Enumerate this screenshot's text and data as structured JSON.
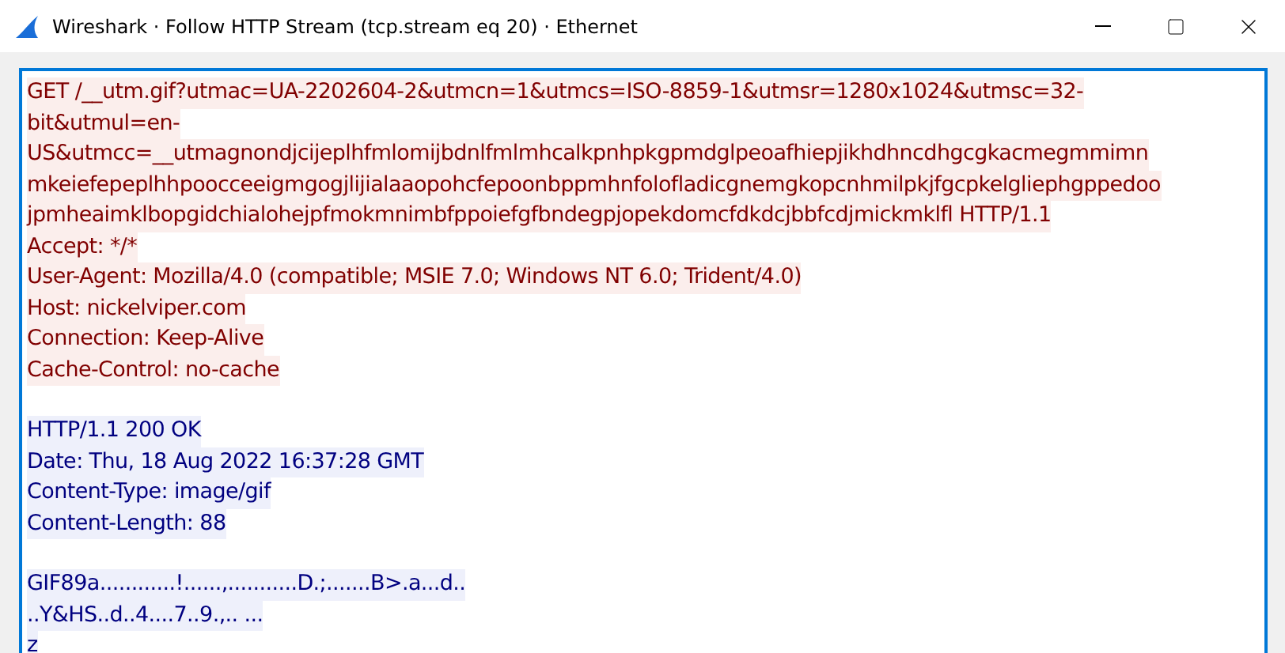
{
  "window": {
    "title": "Wireshark · Follow HTTP Stream (tcp.stream eq 20) · Ethernet"
  },
  "blocks": [
    {
      "kind": "client",
      "lines": [
        "GET /__utm.gif?utmac=UA-2202604-2&utmcn=1&utmcs=ISO-8859-1&utmsr=1280x1024&utmsc=32-",
        "bit&utmul=en-",
        "US&utmcc=__utmagnondjcijeplhfmlomijbdnlfmlmhcalkpnhpkgpmdglpeoafhiepjikhdhncdhgcgkacmegmmimn",
        "mkeiefepeplhhpoocceeigmgogjlijialaaopohcfepoonbppmhnfolofladicgnemgkopcnhmilpkjfgcpkelgliephgppedoo",
        "jpmheaimklbopgidchialohejpfmokmnimbfppoiefgfbndegpjopekdomcfdkdcjbbfcdjmickmklfl HTTP/1.1",
        "Accept: */*",
        "User-Agent: Mozilla/4.0 (compatible; MSIE 7.0; Windows NT 6.0; Trident/4.0)",
        "Host: nickelviper.com",
        "Connection: Keep-Alive",
        "Cache-Control: no-cache"
      ]
    },
    {
      "kind": "server",
      "lines": [
        "HTTP/1.1 200 OK",
        "Date: Thu, 18 Aug 2022 16:37:28 GMT",
        "Content-Type: image/gif",
        "Content-Length: 88"
      ]
    },
    {
      "kind": "server",
      "lines": [
        "GIF89a............!......,...........D.;.......B>.a...d..",
        "..Y&HS..d..4....7..9.,.. ...",
        "z"
      ]
    }
  ]
}
